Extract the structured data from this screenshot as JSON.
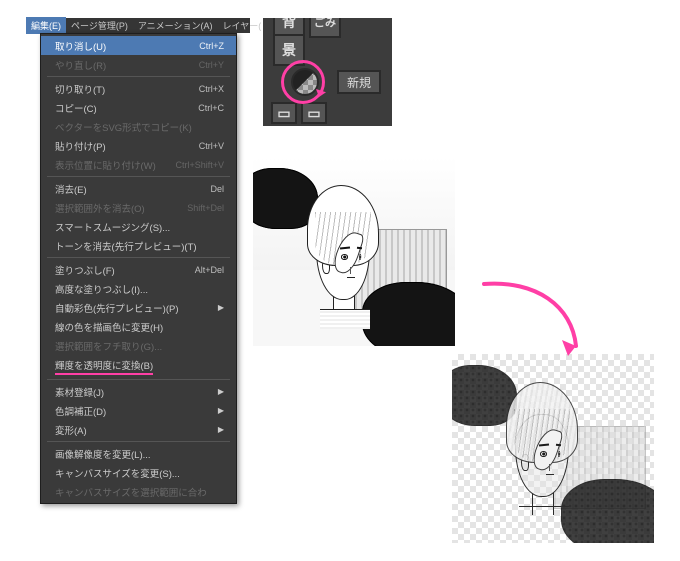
{
  "menubar": {
    "items": [
      "編集(E)",
      "ページ管理(P)",
      "アニメーション(A)",
      "レイヤー("
    ],
    "selected_index": 0
  },
  "menu": {
    "items": [
      {
        "label": "取り消し(U)",
        "hotkey": "Ctrl+Z",
        "selected": true
      },
      {
        "label": "やり直し(R)",
        "hotkey": "Ctrl+Y",
        "disabled": true
      },
      {
        "sep": true
      },
      {
        "label": "切り取り(T)",
        "hotkey": "Ctrl+X"
      },
      {
        "label": "コピー(C)",
        "hotkey": "Ctrl+C"
      },
      {
        "label": "ベクターをSVG形式でコピー(K)",
        "disabled": true
      },
      {
        "label": "貼り付け(P)",
        "hotkey": "Ctrl+V"
      },
      {
        "label": "表示位置に貼り付け(W)",
        "hotkey": "Ctrl+Shift+V",
        "disabled": true
      },
      {
        "sep": true
      },
      {
        "label": "消去(E)",
        "hotkey": "Del"
      },
      {
        "label": "選択範囲外を消去(O)",
        "hotkey": "Shift+Del",
        "disabled": true
      },
      {
        "label": "スマートスムージング(S)..."
      },
      {
        "label": "トーンを消去(先行プレビュー)(T)"
      },
      {
        "sep": true
      },
      {
        "label": "塗りつぶし(F)",
        "hotkey": "Alt+Del"
      },
      {
        "label": "高度な塗りつぶし(I)..."
      },
      {
        "label": "自動彩色(先行プレビュー)(P)",
        "submenu": true
      },
      {
        "label": "線の色を描画色に変更(H)"
      },
      {
        "label": "選択範囲をフチ取り(G)...",
        "disabled": true
      },
      {
        "label": "輝度を透明度に変換(B)",
        "highlighted": true
      },
      {
        "sep": true
      },
      {
        "label": "素材登録(J)",
        "submenu": true
      },
      {
        "label": "色調補正(D)",
        "submenu": true
      },
      {
        "label": "変形(A)",
        "submenu": true
      },
      {
        "sep": true
      },
      {
        "label": "画像解像度を変更(L)..."
      },
      {
        "label": "キャンバスサイズを変更(S)..."
      },
      {
        "label": "キャンバスサイズを選択範囲に合わ",
        "disabled": true
      }
    ]
  },
  "toolbar_zoom": {
    "circled_tool_name": "透明色アイコン",
    "button_right_label": "新規",
    "top_glyph_1": "背",
    "top_glyph_2": "ごみ",
    "top_glyph_3": "景"
  },
  "annotations": {
    "arrow_meaning": "変換前 → 変換後"
  },
  "panels": {
    "before_alt": "輝度を透明度に変換・適用前の人物線画",
    "after_alt": "輝度を透明度に変換・適用後（白が透明化）"
  }
}
